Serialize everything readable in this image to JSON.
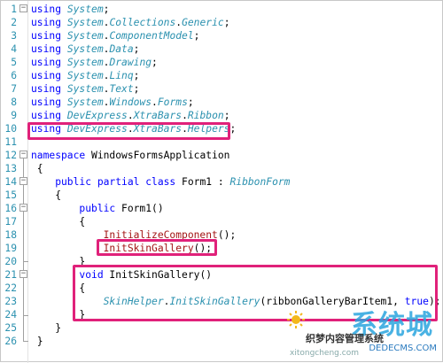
{
  "lines": [
    {
      "n": "1",
      "fold": "⊟",
      "tokens": [
        {
          "t": "using ",
          "c": "kw"
        },
        {
          "t": "System",
          "c": "ty"
        },
        {
          "t": ";",
          "c": "tx"
        }
      ]
    },
    {
      "n": "2",
      "fold": "",
      "tokens": [
        {
          "t": "using ",
          "c": "kw"
        },
        {
          "t": "System",
          "c": "ty"
        },
        {
          "t": ".",
          "c": "tx"
        },
        {
          "t": "Collections",
          "c": "ty"
        },
        {
          "t": ".",
          "c": "tx"
        },
        {
          "t": "Generic",
          "c": "ty"
        },
        {
          "t": ";",
          "c": "tx"
        }
      ]
    },
    {
      "n": "3",
      "fold": "",
      "tokens": [
        {
          "t": "using ",
          "c": "kw"
        },
        {
          "t": "System",
          "c": "ty"
        },
        {
          "t": ".",
          "c": "tx"
        },
        {
          "t": "ComponentModel",
          "c": "ty"
        },
        {
          "t": ";",
          "c": "tx"
        }
      ]
    },
    {
      "n": "4",
      "fold": "",
      "tokens": [
        {
          "t": "using ",
          "c": "kw"
        },
        {
          "t": "System",
          "c": "ty"
        },
        {
          "t": ".",
          "c": "tx"
        },
        {
          "t": "Data",
          "c": "ty"
        },
        {
          "t": ";",
          "c": "tx"
        }
      ]
    },
    {
      "n": "5",
      "fold": "",
      "tokens": [
        {
          "t": "using ",
          "c": "kw"
        },
        {
          "t": "System",
          "c": "ty"
        },
        {
          "t": ".",
          "c": "tx"
        },
        {
          "t": "Drawing",
          "c": "ty"
        },
        {
          "t": ";",
          "c": "tx"
        }
      ]
    },
    {
      "n": "6",
      "fold": "",
      "tokens": [
        {
          "t": "using ",
          "c": "kw"
        },
        {
          "t": "System",
          "c": "ty"
        },
        {
          "t": ".",
          "c": "tx"
        },
        {
          "t": "Linq",
          "c": "ty"
        },
        {
          "t": ";",
          "c": "tx"
        }
      ]
    },
    {
      "n": "7",
      "fold": "",
      "tokens": [
        {
          "t": "using ",
          "c": "kw"
        },
        {
          "t": "System",
          "c": "ty"
        },
        {
          "t": ".",
          "c": "tx"
        },
        {
          "t": "Text",
          "c": "ty"
        },
        {
          "t": ";",
          "c": "tx"
        }
      ]
    },
    {
      "n": "8",
      "fold": "",
      "tokens": [
        {
          "t": "using ",
          "c": "kw"
        },
        {
          "t": "System",
          "c": "ty"
        },
        {
          "t": ".",
          "c": "tx"
        },
        {
          "t": "Windows",
          "c": "ty"
        },
        {
          "t": ".",
          "c": "tx"
        },
        {
          "t": "Forms",
          "c": "ty"
        },
        {
          "t": ";",
          "c": "tx"
        }
      ]
    },
    {
      "n": "9",
      "fold": "",
      "tokens": [
        {
          "t": "using ",
          "c": "kw"
        },
        {
          "t": "DevExpress",
          "c": "ty"
        },
        {
          "t": ".",
          "c": "tx"
        },
        {
          "t": "XtraBars",
          "c": "ty"
        },
        {
          "t": ".",
          "c": "tx"
        },
        {
          "t": "Ribbon",
          "c": "ty"
        },
        {
          "t": ";",
          "c": "tx"
        }
      ]
    },
    {
      "n": "10",
      "fold": "",
      "tokens": [
        {
          "t": "using ",
          "c": "kw"
        },
        {
          "t": "DevExpress",
          "c": "ty"
        },
        {
          "t": ".",
          "c": "tx"
        },
        {
          "t": "XtraBars",
          "c": "ty"
        },
        {
          "t": ".",
          "c": "tx"
        },
        {
          "t": "Helpers",
          "c": "ty"
        },
        {
          "t": ";",
          "c": "tx"
        }
      ]
    },
    {
      "n": "11",
      "fold": "",
      "tokens": []
    },
    {
      "n": "12",
      "fold": "⊟",
      "tokens": [
        {
          "t": "namespace ",
          "c": "kw"
        },
        {
          "t": "WindowsFormsApplication",
          "c": "tx"
        }
      ]
    },
    {
      "n": "13",
      "fold": "",
      "tokens": [
        {
          "t": " {",
          "c": "tx"
        }
      ]
    },
    {
      "n": "14",
      "fold": "⊟",
      "tokens": [
        {
          "t": "    public partial class ",
          "c": "kw"
        },
        {
          "t": "Form1",
          "c": "tx"
        },
        {
          "t": " : ",
          "c": "tx"
        },
        {
          "t": "RibbonForm",
          "c": "ty"
        }
      ]
    },
    {
      "n": "15",
      "fold": "",
      "tokens": [
        {
          "t": "    {",
          "c": "tx"
        }
      ]
    },
    {
      "n": "16",
      "fold": "⊟",
      "tokens": [
        {
          "t": "        public ",
          "c": "kw"
        },
        {
          "t": "Form1()",
          "c": "tx"
        }
      ]
    },
    {
      "n": "17",
      "fold": "",
      "tokens": [
        {
          "t": "        {",
          "c": "tx"
        }
      ]
    },
    {
      "n": "18",
      "fold": "",
      "tokens": [
        {
          "t": "            InitializeComponent",
          "c": "mt"
        },
        {
          "t": "();",
          "c": "tx"
        }
      ]
    },
    {
      "n": "19",
      "fold": "",
      "tokens": [
        {
          "t": "            InitSkinGallery",
          "c": "mt"
        },
        {
          "t": "();",
          "c": "tx"
        }
      ]
    },
    {
      "n": "20",
      "fold": "",
      "tokens": [
        {
          "t": "        }",
          "c": "tx"
        }
      ]
    },
    {
      "n": "21",
      "fold": "⊟",
      "tokens": [
        {
          "t": "        void ",
          "c": "kw"
        },
        {
          "t": "InitSkinGallery()",
          "c": "tx"
        }
      ]
    },
    {
      "n": "22",
      "fold": "",
      "tokens": [
        {
          "t": "        {",
          "c": "tx"
        }
      ]
    },
    {
      "n": "23",
      "fold": "",
      "tokens": [
        {
          "t": "            SkinHelper",
          "c": "ty"
        },
        {
          "t": ".",
          "c": "tx"
        },
        {
          "t": "InitSkinGallery",
          "c": "ty"
        },
        {
          "t": "(ribbonGalleryBarItem1, ",
          "c": "tx"
        },
        {
          "t": "true",
          "c": "kw"
        },
        {
          "t": ");",
          "c": "tx"
        }
      ]
    },
    {
      "n": "24",
      "fold": "",
      "tokens": [
        {
          "t": "        }",
          "c": "tx"
        }
      ]
    },
    {
      "n": "25",
      "fold": "",
      "tokens": [
        {
          "t": "    }",
          "c": "tx"
        }
      ]
    },
    {
      "n": "26",
      "fold": "",
      "tokens": [
        {
          "t": " }",
          "c": "tx"
        }
      ]
    }
  ],
  "watermark": {
    "brand": "系统城",
    "subtitle": "织梦内容管理系统",
    "url": "DEDECMS.COM",
    "url2": "xitongcheng.com"
  },
  "colors": {
    "keyword": "#0000ff",
    "type": "#2b91af",
    "method": "#a31515",
    "highlight": "#e0217a"
  }
}
